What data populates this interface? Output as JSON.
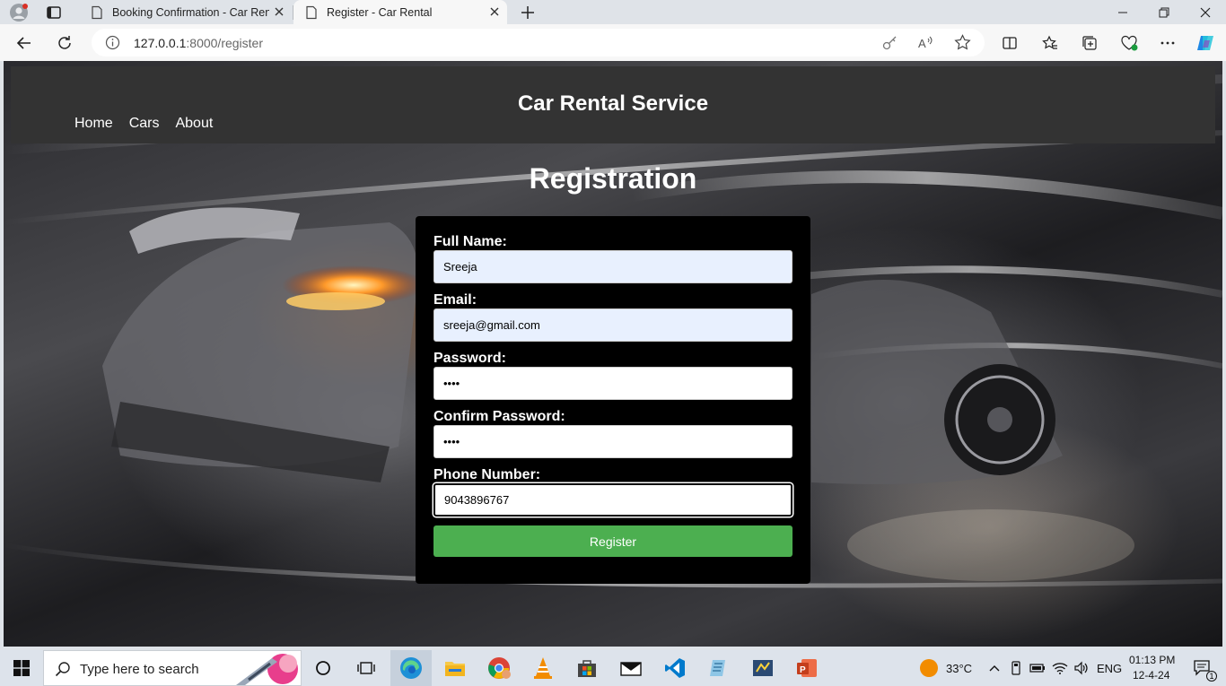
{
  "browser": {
    "tabs": [
      {
        "title": "Booking Confirmation - Car Rent",
        "active": false
      },
      {
        "title": "Register - Car Rental",
        "active": true
      }
    ],
    "address": {
      "host": "127.0.0.1",
      "path": ":8000/register"
    }
  },
  "site": {
    "title": "Car Rental Service",
    "nav": [
      {
        "label": "Home"
      },
      {
        "label": "Cars"
      },
      {
        "label": "About"
      }
    ]
  },
  "form": {
    "heading": "Registration",
    "full_name_label": "Full Name:",
    "full_name_value": "Sreeja",
    "email_label": "Email:",
    "email_value": "sreeja@gmail.com",
    "password_label": "Password:",
    "password_value": "••••",
    "confirm_label": "Confirm Password:",
    "confirm_value": "••••",
    "phone_label": "Phone Number:",
    "phone_value": "9043896767",
    "submit_label": "Register"
  },
  "taskbar": {
    "search_placeholder": "Type here to search",
    "weather": "33°C",
    "language": "ENG",
    "time": "01:13 PM",
    "date": "12-4-24",
    "notification_count": "1"
  },
  "colors": {
    "header_bg": "#333333",
    "form_bg": "#000000",
    "button_bg": "#4caf50",
    "autofill_bg": "#e8f0fe"
  }
}
